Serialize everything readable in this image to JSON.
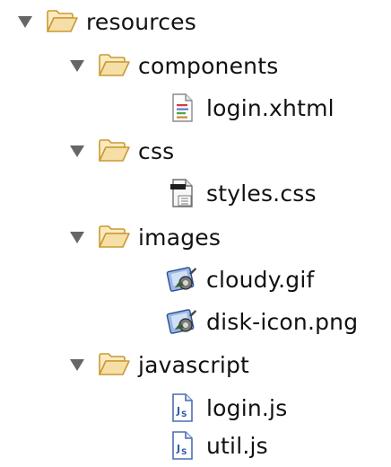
{
  "tree": {
    "root": {
      "label": "resources",
      "expanded": true,
      "icon": "folder-open-icon"
    },
    "components": {
      "label": "components",
      "expanded": true,
      "icon": "folder-open-icon",
      "files": [
        {
          "label": "login.xhtml",
          "icon": "xhtml-file-icon"
        }
      ]
    },
    "css": {
      "label": "css",
      "expanded": true,
      "icon": "folder-open-icon",
      "files": [
        {
          "label": "styles.css",
          "icon": "css-file-icon"
        }
      ]
    },
    "images": {
      "label": "images",
      "expanded": true,
      "icon": "folder-open-icon",
      "files": [
        {
          "label": "cloudy.gif",
          "icon": "image-file-icon"
        },
        {
          "label": "disk-icon.png",
          "icon": "image-file-icon"
        }
      ]
    },
    "javascript": {
      "label": "javascript",
      "expanded": true,
      "icon": "folder-open-icon",
      "files": [
        {
          "label": "login.js",
          "icon": "js-file-icon"
        },
        {
          "label": "util.js",
          "icon": "js-file-icon"
        }
      ]
    }
  },
  "colors": {
    "folder_fill": "#f6dfa6",
    "folder_stroke": "#c99a35",
    "twisty": "#666666",
    "text": "#111111"
  }
}
